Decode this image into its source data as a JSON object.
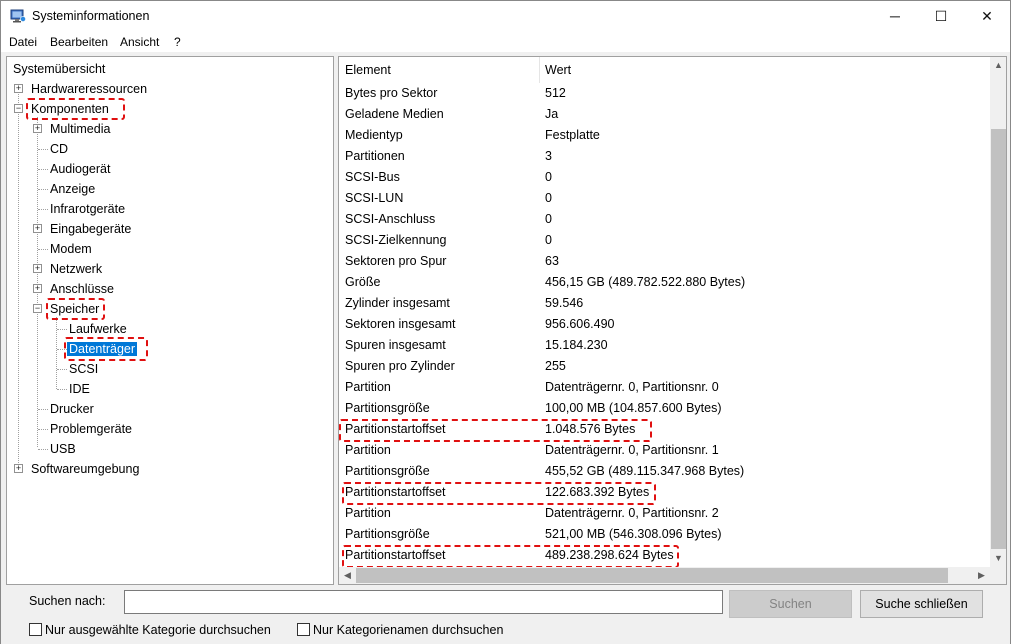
{
  "window": {
    "title": "Systeminformationen",
    "minimize_glyph": "─",
    "maximize_glyph": "☐",
    "close_glyph": "✕"
  },
  "menu": {
    "items": [
      "Datei",
      "Bearbeiten",
      "Ansicht",
      "?"
    ]
  },
  "tree": {
    "root": "Systemübersicht",
    "items": [
      "Hardwareressourcen",
      "Komponenten",
      "Multimedia",
      "CD",
      "Audiogerät",
      "Anzeige",
      "Infrarotgeräte",
      "Eingabegeräte",
      "Modem",
      "Netzwerk",
      "Anschlüsse",
      "Speicher",
      "Laufwerke",
      "Datenträger",
      "SCSI",
      "IDE",
      "Drucker",
      "Problemgeräte",
      "USB",
      "Softwareumgebung"
    ],
    "selected": "Datenträger",
    "expand_plus": "+",
    "expand_minus": "−"
  },
  "list": {
    "columns": [
      "Element",
      "Wert"
    ],
    "rows": [
      [
        "Bytes pro Sektor",
        "512"
      ],
      [
        "Geladene Medien",
        "Ja"
      ],
      [
        "Medientyp",
        "Festplatte"
      ],
      [
        "Partitionen",
        "3"
      ],
      [
        "SCSI-Bus",
        "0"
      ],
      [
        "SCSI-LUN",
        "0"
      ],
      [
        "SCSI-Anschluss",
        "0"
      ],
      [
        "SCSI-Zielkennung",
        "0"
      ],
      [
        "Sektoren pro Spur",
        "63"
      ],
      [
        "Größe",
        "456,15 GB (489.782.522.880 Bytes)"
      ],
      [
        "Zylinder insgesamt",
        "59.546"
      ],
      [
        "Sektoren insgesamt",
        "956.606.490"
      ],
      [
        "Spuren insgesamt",
        "15.184.230"
      ],
      [
        "Spuren pro Zylinder",
        "255"
      ],
      [
        "Partition",
        "Datenträgernr. 0, Partitionsnr. 0"
      ],
      [
        "Partitionsgröße",
        "100,00 MB (104.857.600 Bytes)"
      ],
      [
        "Partitionstartoffset",
        "1.048.576 Bytes"
      ],
      [
        "Partition",
        "Datenträgernr. 0, Partitionsnr. 1"
      ],
      [
        "Partitionsgröße",
        "455,52 GB (489.115.347.968 Bytes)"
      ],
      [
        "Partitionstartoffset",
        "122.683.392 Bytes"
      ],
      [
        "Partition",
        "Datenträgernr. 0, Partitionsnr. 2"
      ],
      [
        "Partitionsgröße",
        "521,00 MB (546.308.096 Bytes)"
      ],
      [
        "Partitionstartoffset",
        "489.238.298.624 Bytes"
      ]
    ],
    "scroll_up": "▲",
    "scroll_down": "▼",
    "scroll_left": "◀",
    "scroll_right": "▶"
  },
  "search": {
    "label": "Suchen nach:",
    "value": "",
    "search_button": "Suchen",
    "close_button": "Suche schließen",
    "check_selected_category": "Nur ausgewählte Kategorie durchsuchen",
    "check_category_names": "Nur Kategorienamen durchsuchen"
  },
  "colors": {
    "highlight": "#e01010",
    "selection": "#0078d7"
  }
}
